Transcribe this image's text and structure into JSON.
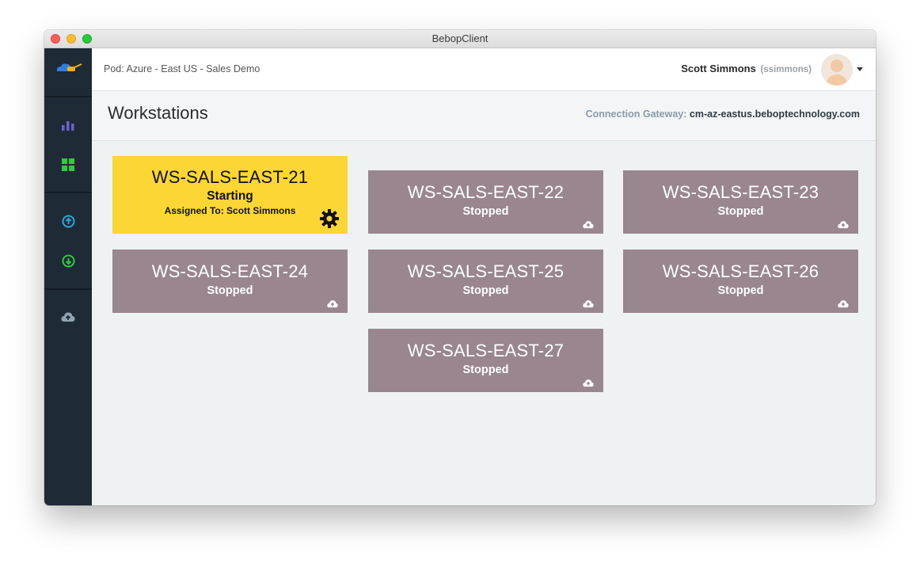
{
  "window": {
    "title": "BebopClient"
  },
  "topbar": {
    "pod": "Pod: Azure - East US - Sales Demo",
    "user_name": "Scott Simmons",
    "user_handle": "(ssimmons)"
  },
  "header": {
    "title": "Workstations",
    "gateway_label": "Connection Gateway:",
    "gateway_value": "cm-az-eastus.beboptechnology.com"
  },
  "sidebar": {
    "icons": [
      "logo-icon",
      "bar-chart-icon",
      "grid-icon",
      "upload-circle-icon",
      "download-circle-icon",
      "cloud-upload-icon"
    ]
  },
  "workstations": [
    {
      "name": "WS-SALS-EAST-21",
      "status": "Starting",
      "assigned": "Assigned To: Scott Simmons",
      "icon": "gear-icon"
    },
    {
      "name": "WS-SALS-EAST-22",
      "status": "Stopped",
      "icon": "cloud-upload-icon"
    },
    {
      "name": "WS-SALS-EAST-23",
      "status": "Stopped",
      "icon": "cloud-upload-icon"
    },
    {
      "name": "WS-SALS-EAST-24",
      "status": "Stopped",
      "icon": "cloud-upload-icon"
    },
    {
      "name": "WS-SALS-EAST-25",
      "status": "Stopped",
      "icon": "cloud-upload-icon"
    },
    {
      "name": "WS-SALS-EAST-26",
      "status": "Stopped",
      "icon": "cloud-upload-icon"
    },
    {
      "name": "WS-SALS-EAST-27",
      "status": "Stopped",
      "icon": "cloud-upload-icon"
    }
  ],
  "colors": {
    "sidebar": "#1e2a35",
    "tile_stopped": "#99868f",
    "tile_active": "#fbd634",
    "accent_green": "#2ecc40",
    "accent_blue": "#2aa7d8",
    "accent_purple": "#6a63c9"
  }
}
